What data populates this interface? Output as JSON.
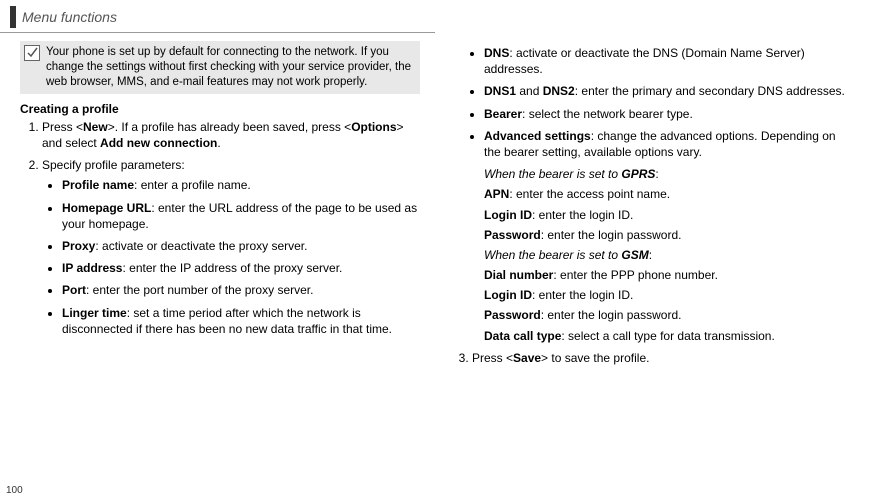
{
  "header": {
    "title": "Menu functions"
  },
  "pageNumber": "100",
  "note": {
    "text": "Your phone is set up by default for connecting to the network. If you change the settings without first checking with your service provider, the web browser, MMS, and e-mail features may not work properly."
  },
  "section": {
    "creatingProfile": "Creating a profile"
  },
  "steps": {
    "s1a": "Press <",
    "s1b": "New",
    "s1c": ">. If a profile has already been saved, press <",
    "s1d": "Options",
    "s1e": "> and select ",
    "s1f": "Add new connection",
    "s1g": ".",
    "s2": "Specify profile parameters:",
    "s3a": "Press <",
    "s3b": "Save",
    "s3c": "> to save the profile."
  },
  "bulletsLeft": {
    "b1a": "Profile name",
    "b1b": ": enter a profile name.",
    "b2a": "Homepage URL",
    "b2b": ": enter the URL address of the page to be used as your homepage.",
    "b3a": "Proxy",
    "b3b": ": activate or deactivate the proxy server.",
    "b4a": "IP address",
    "b4b": ": enter the IP address of the proxy server.",
    "b5a": "Port",
    "b5b": ": enter the port number of the proxy server.",
    "b6a": "Linger time",
    "b6b": ": set a time period after which the network is disconnected if there has been no new data traffic in that time."
  },
  "bulletsRight": {
    "b1a": "DNS",
    "b1b": ": activate or deactivate the DNS (Domain Name Server) addresses.",
    "b2a": "DNS1",
    "b2b": " and ",
    "b2c": "DNS2",
    "b2d": ": enter the primary and secondary DNS addresses.",
    "b3a": "Bearer",
    "b3b": ": select the network bearer type.",
    "b4a": "Advanced settings",
    "b4b": ": change the advanced options. Depending on the bearer setting, available options vary."
  },
  "adv": {
    "gprsTitle_a": "When the bearer is set to ",
    "gprsTitle_b": "GPRS",
    "gprsTitle_c": ":",
    "apn_a": "APN",
    "apn_b": ": enter the access point name.",
    "login_a": "Login ID",
    "login_b": ": enter the login ID.",
    "pass_a": "Password",
    "pass_b": ": enter the login password.",
    "gsmTitle_a": "When the bearer is set to ",
    "gsmTitle_b": "GSM",
    "gsmTitle_c": ":",
    "dial_a": "Dial number",
    "dial_b": ": enter the PPP phone number.",
    "login2_a": "Login ID",
    "login2_b": ": enter the login ID.",
    "pass2_a": "Password",
    "pass2_b": ": enter the login password.",
    "dct_a": "Data call type",
    "dct_b": ": select a call type for data transmission."
  }
}
